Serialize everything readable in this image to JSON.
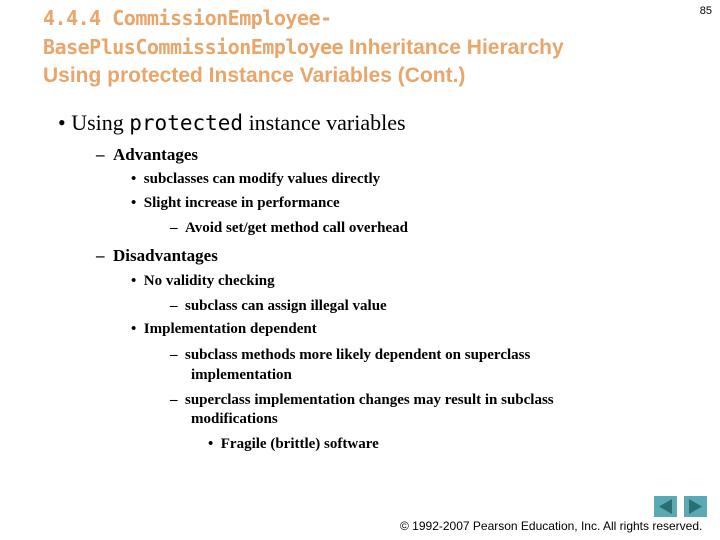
{
  "slide": {
    "title_mono_1": "4.4.4 CommissionEmployee-",
    "title_mono_2": "BasePlusCommissionEmployee",
    "title_text_2": " Inheritance Hierarchy",
    "title_line_3": "Using protected Instance Variables (Cont.)",
    "page_number": "85"
  },
  "body": {
    "main_bullet": {
      "pre": "Using ",
      "code": "protected",
      "post": " instance variables"
    },
    "advantages": {
      "label": "Advantages",
      "items": [
        "subclasses can modify values directly",
        "Slight increase in performance"
      ],
      "sub_items": [
        "Avoid set/get method call overhead"
      ]
    },
    "disadvantages": {
      "label": "Disadvantages",
      "item1": "No validity checking",
      "item1_sub": "subclass can assign illegal value",
      "item2": "Implementation dependent",
      "item2_sub1_a": "subclass methods more likely dependent on superclass",
      "item2_sub1_b": "implementation",
      "item2_sub2_a": "superclass implementation changes may result in subclass",
      "item2_sub2_b": "modifications",
      "item2_sub2_sub": "Fragile (brittle) software"
    }
  },
  "footer": {
    "copyright": "© 1992-2007 Pearson Education, Inc.  All rights reserved.",
    "prev_icon": "triangle-left",
    "next_icon": "triangle-right"
  },
  "glyphs": {
    "bullet": "•",
    "dash": "–"
  }
}
